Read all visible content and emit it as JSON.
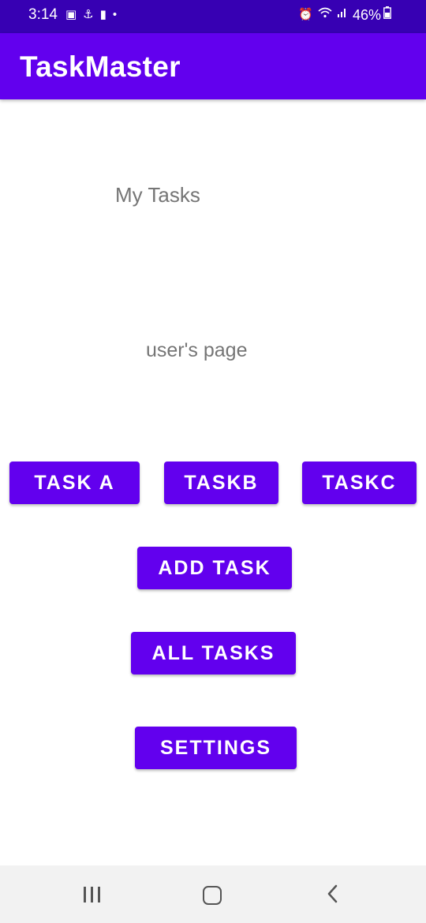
{
  "status_bar": {
    "time": "3:14",
    "battery": "46%",
    "left_icons": [
      "gallery-icon",
      "accessibility-icon",
      "message-icon",
      "dot-icon"
    ],
    "right_icons": [
      "alarm-icon",
      "wifi-icon",
      "signal-icon",
      "battery-icon"
    ]
  },
  "app_bar": {
    "title": "TaskMaster",
    "color": "#6200ee"
  },
  "main": {
    "heading": "My Tasks",
    "subheading": "user's page",
    "text_color": "#757575"
  },
  "buttons": {
    "task_a": "TASK A",
    "task_b": "TASKB",
    "task_c": "TASKC",
    "add_task": "ADD TASK",
    "all_tasks": "ALL TASKS",
    "settings": "SETTINGS",
    "color": "#6200ee"
  },
  "nav_bar": {
    "icons": [
      "recents-icon",
      "home-icon",
      "back-icon"
    ]
  }
}
